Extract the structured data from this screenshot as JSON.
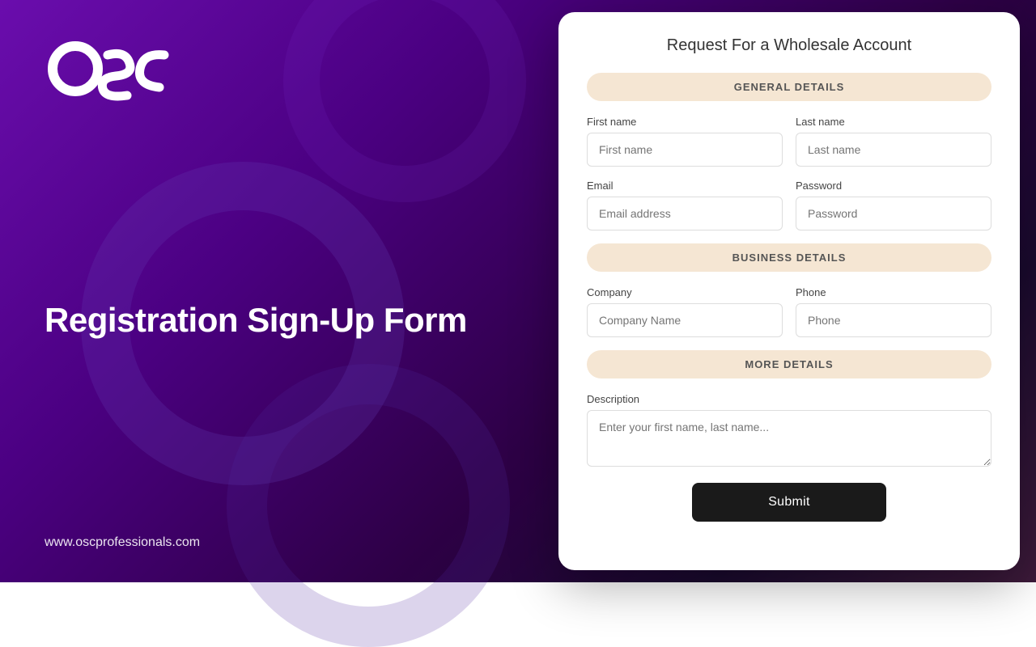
{
  "background": {
    "alt": "gradient background"
  },
  "left": {
    "logo_alt": "OSC Logo",
    "title": "Registration Sign-Up Form",
    "url": "www.oscprofessionals.com"
  },
  "form": {
    "title": "Request For a Wholesale Account",
    "sections": {
      "general": {
        "header": "GENERAL DETAILS",
        "first_name_label": "First name",
        "first_name_placeholder": "First name",
        "last_name_label": "Last name",
        "last_name_placeholder": "Last name",
        "email_label": "Email",
        "email_placeholder": "Email address",
        "password_label": "Password",
        "password_placeholder": "Password"
      },
      "business": {
        "header": "BUSINESS DETAILS",
        "company_label": "Company",
        "company_placeholder": "Company Name",
        "phone_label": "Phone",
        "phone_placeholder": "Phone"
      },
      "more": {
        "header": "MORE DETAILS",
        "description_label": "Description",
        "description_placeholder": "Enter your first name, last name..."
      }
    },
    "submit_label": "Submit"
  }
}
